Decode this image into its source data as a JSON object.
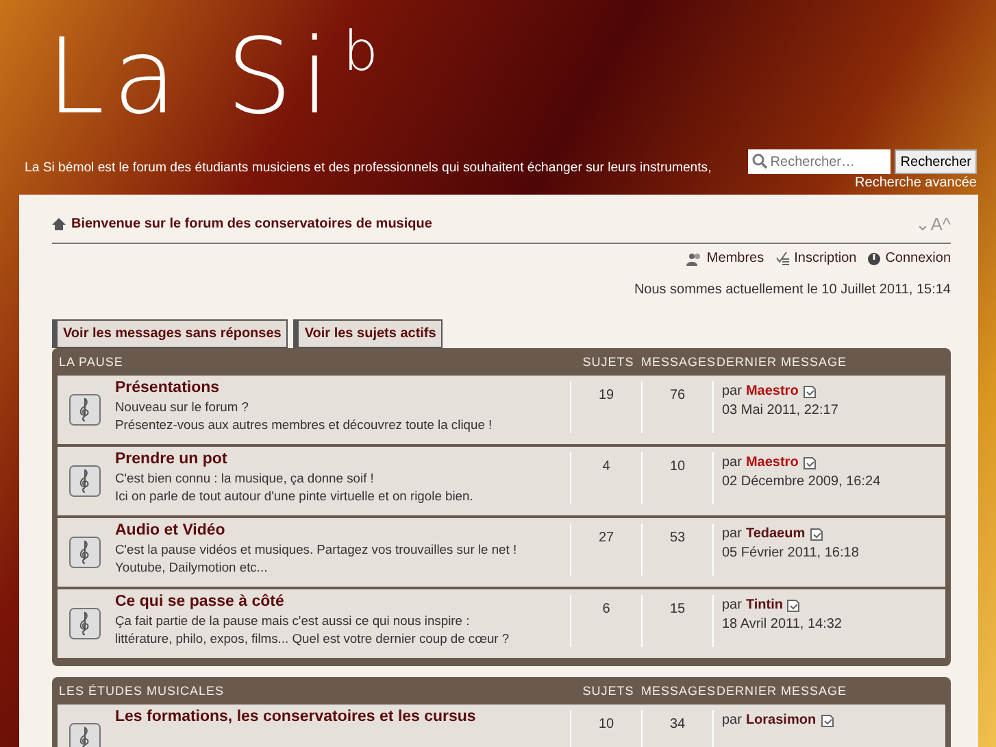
{
  "header": {
    "logo": "La Si",
    "logo_sup": "b",
    "tagline": "La Si bémol est le forum des étudiants musiciens et des professionnels qui souhaitent échanger sur leurs instruments,",
    "search": {
      "placeholder": "Rechercher…",
      "button": "Rechercher",
      "advanced": "Recherche avancée"
    }
  },
  "breadcrumb": "Bienvenue sur le forum des conservatoires de musique",
  "font_size_control": {
    "decrease": "⌄",
    "label": "A",
    "increase": "^"
  },
  "user_links": [
    {
      "kind": "members",
      "label": "Membres"
    },
    {
      "kind": "register",
      "label": "Inscription"
    },
    {
      "kind": "login",
      "label": "Connexion"
    }
  ],
  "current_time": "Nous sommes actuellement le 10 Juillet 2011, 15:14",
  "action_buttons": [
    "Voir les messages sans réponses",
    "Voir les sujets actifs"
  ],
  "categories": [
    {
      "title": "LA PAUSE",
      "columns": [
        "SUJETS",
        "MESSAGES",
        "DERNIER MESSAGE"
      ],
      "forums": [
        {
          "title": "Présentations",
          "description": [
            "Nouveau sur le forum ?",
            "Présentez-vous aux autres membres et découvrez toute la clique !"
          ],
          "topics": "19",
          "posts": "76",
          "by": "par",
          "author": "Maestro",
          "color": "#b0100f",
          "date": "03 Mai 2011, 22:17"
        },
        {
          "title": "Prendre un pot",
          "description": [
            "C'est bien connu : la musique, ça donne soif !",
            "Ici on parle de tout autour d'une pinte virtuelle et on rigole bien."
          ],
          "topics": "4",
          "posts": "10",
          "by": "par",
          "author": "Maestro",
          "color": "#b0100f",
          "date": "02 Décembre 2009, 16:24"
        },
        {
          "title": "Audio et Vidéo",
          "description": [
            "C'est la pause vidéos et musiques. Partagez vos trouvailles sur le net !",
            "Youtube, Dailymotion etc..."
          ],
          "topics": "27",
          "posts": "53",
          "by": "par",
          "author": "Tedaeum",
          "color": "#5a1010",
          "date": "05 Février 2011, 16:18"
        },
        {
          "title": "Ce qui se passe à côté",
          "description": [
            "Ça fait partie de la pause mais c'est aussi ce qui nous inspire :",
            "littérature, philo, expos, films... Quel est votre dernier coup de cœur ?"
          ],
          "topics": "6",
          "posts": "15",
          "by": "par",
          "author": "Tintin",
          "color": "#5a1010",
          "date": "18 Avril 2011, 14:32"
        }
      ]
    },
    {
      "title": "LES ÉTUDES MUSICALES",
      "columns": [
        "SUJETS",
        "MESSAGES",
        "DERNIER MESSAGE"
      ],
      "forums": [
        {
          "title": "Les formations, les conservatoires et les cursus",
          "topics": "10",
          "posts": "34",
          "by": "par",
          "author": "Lorasimon",
          "color": "#5a1010"
        }
      ]
    }
  ]
}
